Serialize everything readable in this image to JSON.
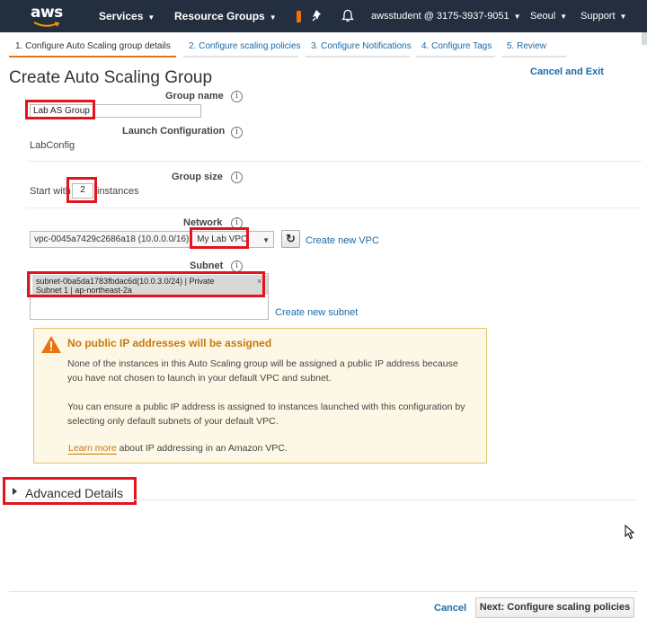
{
  "nav": {
    "logo": "aws",
    "services": "Services",
    "resource_groups": "Resource Groups",
    "account": "awsstudent @ 3175-3937-9051",
    "region": "Seoul",
    "support": "Support"
  },
  "steps": [
    {
      "label": "1. Configure Auto Scaling group details",
      "active": true
    },
    {
      "label": "2. Configure scaling policies",
      "active": false
    },
    {
      "label": "3. Configure Notifications",
      "active": false
    },
    {
      "label": "4. Configure Tags",
      "active": false
    },
    {
      "label": "5. Review",
      "active": false
    }
  ],
  "page": {
    "title": "Create Auto Scaling Group",
    "cancel_exit": "Cancel and Exit"
  },
  "form": {
    "group_name_label": "Group name",
    "group_name_value": "Lab AS Group",
    "launch_config_label": "Launch Configuration",
    "launch_config_value": "LabConfig",
    "group_size_label": "Group size",
    "start_with": "Start with",
    "instances_value": "2",
    "instances_suffix": "instances",
    "network_label": "Network",
    "vpc_id": "vpc-0045a7429c2686a18 (10.0.0.0/16)",
    "vpc_name": "My Lab VPC",
    "create_vpc": "Create new VPC",
    "subnet_label": "Subnet",
    "subnet_line1": "subnet-0ba5da1783fbdac6d(10.0.3.0/24) | Private",
    "subnet_line2": "Subnet 1 | ap-northeast-2a",
    "create_subnet": "Create new subnet"
  },
  "warning": {
    "title": "No public IP addresses will be assigned",
    "p1_line1": "None of the instances in this Auto Scaling group will be assigned a public IP address because",
    "p1_line2": "you have not chosen to launch in your default VPC and subnet.",
    "p2_line1": "You can ensure a public IP address is assigned to instances launched with this configuration by",
    "p2_line2": "selecting only default subnets of your default VPC.",
    "learn_more": "Learn more",
    "learn_more_suffix": "about IP addressing in an Amazon VPC."
  },
  "advanced": {
    "label": "Advanced Details"
  },
  "footer": {
    "cancel": "Cancel",
    "next": "Next: Configure scaling policies"
  },
  "colors": {
    "nav_bg": "#232f3e",
    "link": "#1a6aa8",
    "active_step": "#ec7211",
    "highlight": "#e3141e",
    "warning_title": "#c8780c",
    "warning_bg": "#fdf8e6"
  },
  "icons": [
    "pin-icon",
    "bell-icon",
    "info-icon",
    "refresh-icon",
    "warning-icon",
    "caret-right-icon",
    "mouse-cursor-icon"
  ]
}
